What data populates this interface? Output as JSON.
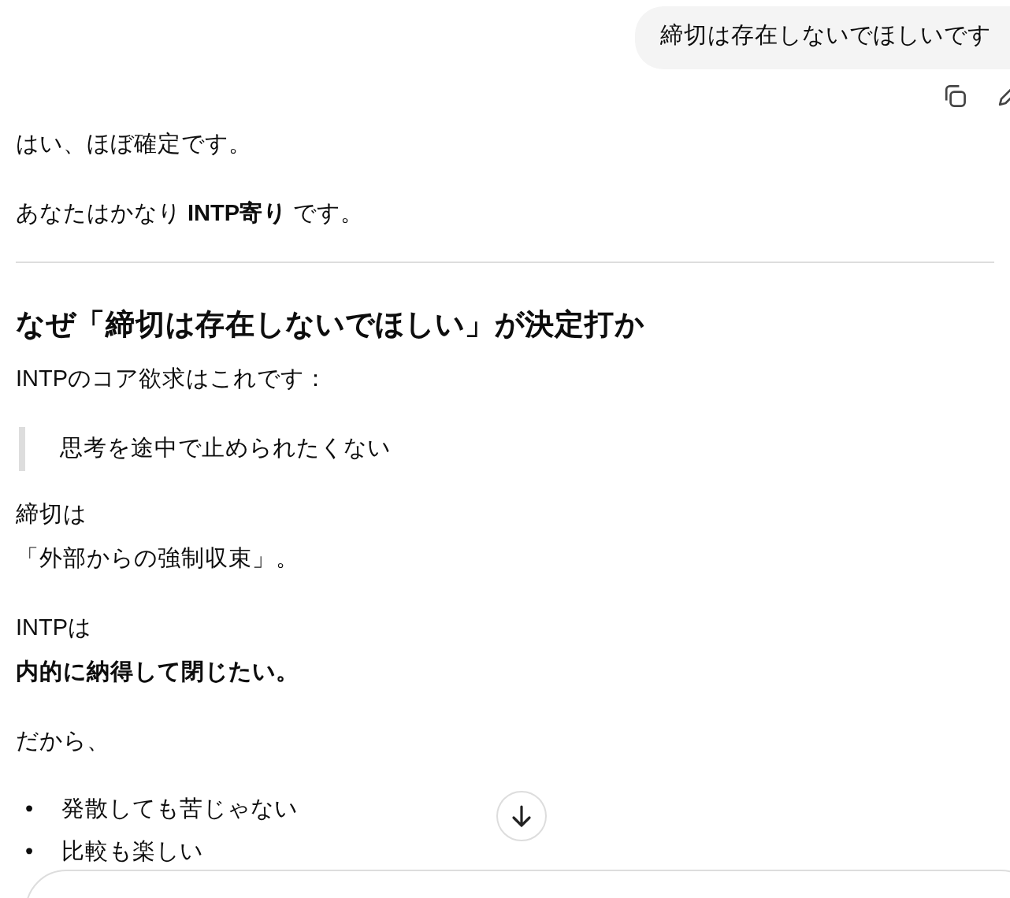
{
  "user_message": {
    "text": "締切は存在しないでほしいです"
  },
  "message_actions": [
    {
      "kind": "copy"
    },
    {
      "kind": "edit"
    }
  ],
  "response": [
    {
      "kind": "paragraph",
      "lines": [
        "はい、ほぼ確定です。"
      ]
    },
    {
      "kind": "paragraph",
      "lines": [
        "あなたはかなり **INTP寄り** です。"
      ]
    },
    {
      "kind": "divider"
    },
    {
      "kind": "heading",
      "lines": [
        "なぜ「締切は存在しないでほしい」が決定打か"
      ]
    },
    {
      "kind": "paragraph",
      "lines": [
        "INTPのコア欲求はこれです："
      ]
    },
    {
      "kind": "quote",
      "lines": [
        "思考を途中で止められたくない"
      ]
    },
    {
      "kind": "paragraph",
      "lines": [
        "締切は",
        "「外部からの強制収束」。"
      ]
    },
    {
      "kind": "paragraph",
      "lines": [
        "INTPは",
        "**内的に納得して閉じたい。**"
      ]
    },
    {
      "kind": "paragraph",
      "lines": [
        "だから、"
      ]
    },
    {
      "kind": "bullets",
      "items": [
        {
          "marker": "•",
          "text": "発散しても苦じゃない"
        },
        {
          "marker": "•",
          "text": "比較も楽しい"
        }
      ]
    }
  ],
  "scroll_down_button": {
    "kind": "arrow"
  }
}
